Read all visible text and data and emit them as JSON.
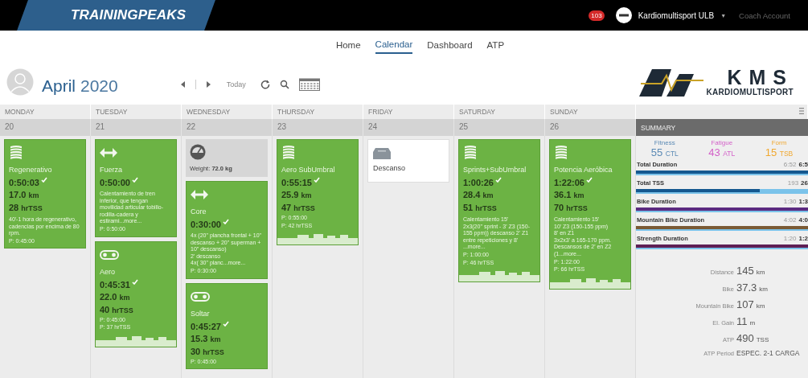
{
  "top_bar": {
    "brand": "TRAININGPEAKS",
    "notifications": "103",
    "account": "Kardiomultisport ULB",
    "account_caret": "▼",
    "coach_link": "Coach Account"
  },
  "nav": [
    {
      "label": "Home",
      "selected": false
    },
    {
      "label": "Calendar",
      "selected": true
    },
    {
      "label": "Dashboard",
      "selected": false
    },
    {
      "label": "ATP",
      "selected": false
    }
  ],
  "header": {
    "month": "April",
    "year": "2020",
    "today": "Today"
  },
  "logo": {
    "title": "KMS",
    "subtitle": "KARDIOMULTISPORT"
  },
  "days": [
    {
      "name": "MONDAY",
      "date": "20",
      "items": [
        {
          "kind": "mtb_workout",
          "title": "Regenerativo",
          "duration": "0:50:03",
          "completed": true,
          "distance": "17.0",
          "distance_unit": "km",
          "tss": "28",
          "tss_unit": "hrTSS",
          "description": "40'-1 hora de regenerativo, cadencias por encima de 80 rpm.",
          "planned": [
            "P: 0:45:00"
          ],
          "graph": false
        }
      ]
    },
    {
      "name": "TUESDAY",
      "date": "21",
      "items": [
        {
          "kind": "strength_workout",
          "title": "Fuerza",
          "duration": "0:50:00",
          "completed": true,
          "description": "Calentamiento de tren inferior, que tengan movilidad articular tobillo-rodilla-cadera y estirami...more...",
          "planned": [
            "P: 0:50:00"
          ],
          "graph": false
        },
        {
          "kind": "bike_workout",
          "title": "Aero",
          "duration": "0:45:31",
          "completed": true,
          "distance": "22.0",
          "distance_unit": "km",
          "tss": "40",
          "tss_unit": "hrTSS",
          "planned": [
            "P: 0:45:00",
            "P: 37 hrTSS"
          ],
          "graph": true
        }
      ]
    },
    {
      "name": "WEDNESDAY",
      "date": "22",
      "items": [
        {
          "kind": "metric",
          "text": "Weight: **72.0 kg**"
        },
        {
          "kind": "strength_workout",
          "title": "Core",
          "duration": "0:30:00",
          "completed": true,
          "description": "4x (20\" plancha frontal + 10\" descanso + 20\" superman + 10\" descanso)\n2' descanso\n4x( 30\" planc...more...",
          "planned": [
            "P: 0:30:00"
          ],
          "graph": false
        },
        {
          "kind": "bike_workout",
          "title": "Soltar",
          "duration": "0:45:27",
          "completed": true,
          "distance": "15.3",
          "distance_unit": "km",
          "tss": "30",
          "tss_unit": "hrTSS",
          "planned": [
            "P: 0:45:00"
          ],
          "graph": false
        }
      ]
    },
    {
      "name": "THURSDAY",
      "date": "23",
      "items": [
        {
          "kind": "mtb_workout",
          "title": "Aero SubUmbral",
          "duration": "0:55:15",
          "completed": true,
          "distance": "25.9",
          "distance_unit": "km",
          "tss": "47",
          "tss_unit": "hrTSS",
          "planned": [
            "P: 0:55:00",
            "P: 42 hrTSS"
          ],
          "graph": true
        }
      ]
    },
    {
      "name": "FRIDAY",
      "date": "24",
      "items": [
        {
          "kind": "rest",
          "title": "Descanso"
        }
      ]
    },
    {
      "name": "SATURDAY",
      "date": "25",
      "items": [
        {
          "kind": "mtb_workout",
          "title": "Sprints+SubUmbral",
          "duration": "1:00:26",
          "completed": true,
          "distance": "28.4",
          "distance_unit": "km",
          "tss": "51",
          "tss_unit": "hrTSS",
          "description": "Calentamiento 15'\n2x3(20'' sprint - 3' Z3 (150-155 ppm)) descanso 2' Z1 entre repeticiones y 8' ...more...",
          "planned": [
            "P: 1:00:00",
            "P: 46 hrTSS"
          ],
          "graph": true
        }
      ]
    },
    {
      "name": "SUNDAY",
      "date": "26",
      "items": [
        {
          "kind": "mtb_workout",
          "title": "Potencia Aeróbica",
          "duration": "1:22:06",
          "completed": true,
          "distance": "36.1",
          "distance_unit": "km",
          "tss": "70",
          "tss_unit": "hrTSS",
          "description": "Calentamiento 15'\n10' Z3 (150-155 ppm)\n8' en Z1\n3x2x3' a 165-170 ppm. Descansos de 2' en Z2 (1...more...",
          "planned": [
            "P: 1:22:00",
            "P: 66 hrTSS"
          ],
          "graph": true
        }
      ]
    }
  ],
  "summary": {
    "title": "SUMMARY",
    "fitness": [
      {
        "label": "Fitness",
        "value": "55",
        "unit": "CTL",
        "color": "#5b8ab5"
      },
      {
        "label": "Fatigue",
        "value": "43",
        "unit": "ATL",
        "color": "#d35fc8"
      },
      {
        "label": "Form",
        "value": "15",
        "unit": "TSB",
        "color": "#f0a830"
      }
    ],
    "totals": [
      {
        "label": "Total Duration",
        "planned": "6:52",
        "completed": "6:5",
        "level": 1,
        "color": "#15588f"
      },
      {
        "label": "Total TSS",
        "planned": "193",
        "completed": "26",
        "level": 0.72,
        "color": "#15588f"
      },
      {
        "label": "Bike Duration",
        "planned": "1:30",
        "completed": "1:3",
        "level": 1,
        "color": "#5b2a80"
      },
      {
        "label": "Mountain Bike Duration",
        "planned": "4:02",
        "completed": "4:0",
        "level": 1,
        "color": "#7a5a35"
      },
      {
        "label": "Strength Duration",
        "planned": "1:20",
        "completed": "1:2",
        "level": 1,
        "color": "#5e1f55"
      }
    ],
    "stats": [
      {
        "label": "Distance",
        "value": "145",
        "unit": "km"
      },
      {
        "label": "Bike",
        "value": "37.3",
        "unit": "km"
      },
      {
        "label": "Mountain Bike",
        "value": "107",
        "unit": "km"
      },
      {
        "label": "El. Gain",
        "value": "11",
        "unit": "m"
      },
      {
        "label": "ATP",
        "value": "490",
        "unit": "TSS"
      },
      {
        "label": "ATP Period",
        "value": "ESPEC. 2-1 CARGA"
      }
    ]
  }
}
